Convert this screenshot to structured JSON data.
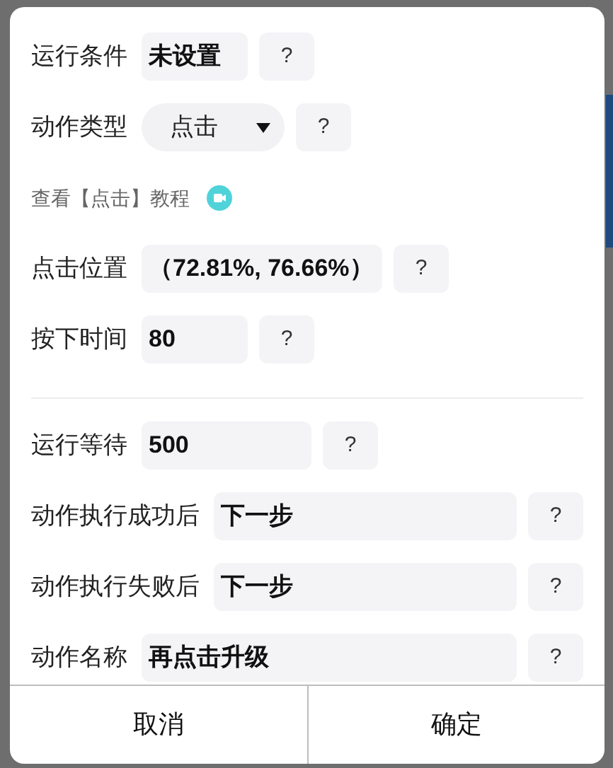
{
  "groups": [
    [
      {
        "kind": "field",
        "label": "运行条件",
        "value": "未设置",
        "help": "?"
      },
      {
        "kind": "select",
        "label": "动作类型",
        "value": "点击",
        "help": "?"
      },
      {
        "kind": "link",
        "label": "查看【点击】教程"
      },
      {
        "kind": "field",
        "label": "点击位置",
        "value": "（72.81%, 76.66%）",
        "help": "?"
      },
      {
        "kind": "field",
        "label": "按下时间",
        "value": "80",
        "help": "?"
      }
    ],
    [
      {
        "kind": "field",
        "label": "运行等待",
        "value": "500",
        "help": "?"
      },
      {
        "kind": "field",
        "label": "动作执行成功后",
        "value": "下一步",
        "help": "?"
      },
      {
        "kind": "field",
        "label": "动作执行失败后",
        "value": "下一步",
        "help": "?"
      },
      {
        "kind": "field",
        "label": "动作名称",
        "value": "再点击升级",
        "help": "?"
      }
    ]
  ],
  "buttons": [
    "取消",
    "确定"
  ]
}
